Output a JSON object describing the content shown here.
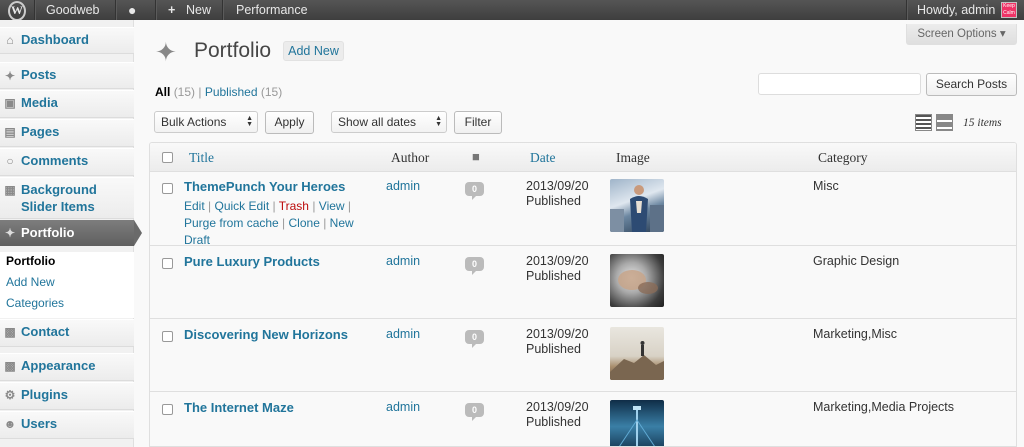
{
  "adminbar": {
    "site_name": "Goodweb",
    "new_label": "New",
    "performance_label": "Performance",
    "howdy": "Howdy, admin"
  },
  "sidebar": {
    "items": [
      {
        "label": "Dashboard",
        "icon": "dashboard-icon"
      },
      {
        "label": "Posts",
        "icon": "pin-icon"
      },
      {
        "label": "Media",
        "icon": "media-icon"
      },
      {
        "label": "Pages",
        "icon": "pages-icon"
      },
      {
        "label": "Comments",
        "icon": "comments-icon"
      },
      {
        "label": "Background Slider Items",
        "icon": "slider-icon"
      },
      {
        "label": "Portfolio",
        "icon": "pin-icon"
      },
      {
        "label": "Contact",
        "icon": "contact-icon"
      },
      {
        "label": "Appearance",
        "icon": "appearance-icon"
      },
      {
        "label": "Plugins",
        "icon": "plugins-icon"
      },
      {
        "label": "Users",
        "icon": "users-icon"
      }
    ],
    "submenu": [
      "Portfolio",
      "Add New",
      "Categories"
    ]
  },
  "header": {
    "screen_options": "Screen Options",
    "title": "Portfolio",
    "add_new": "Add New"
  },
  "filters": {
    "all_label": "All",
    "all_count": "(15)",
    "published_label": "Published",
    "published_count": "(15)",
    "search_button": "Search Posts",
    "bulk_actions": "Bulk Actions",
    "apply": "Apply",
    "dates": "Show all dates",
    "filter": "Filter",
    "items_count": "15 items"
  },
  "table": {
    "columns": [
      "Title",
      "Author",
      "Date",
      "Image",
      "Category"
    ],
    "row_actions": [
      "Edit",
      "Quick Edit",
      "Trash",
      "View",
      "Purge from cache",
      "Clone",
      "New Draft"
    ],
    "rows": [
      {
        "title": "ThemePunch Your Heroes",
        "author": "admin",
        "comments": "0",
        "date": "2013/09/20",
        "status": "Published",
        "category": "Misc"
      },
      {
        "title": "Pure Luxury Products",
        "author": "admin",
        "comments": "0",
        "date": "2013/09/20",
        "status": "Published",
        "category": "Graphic Design"
      },
      {
        "title": "Discovering New Horizons",
        "author": "admin",
        "comments": "0",
        "date": "2013/09/20",
        "status": "Published",
        "category": "Marketing,Misc"
      },
      {
        "title": "The Internet Maze",
        "author": "admin",
        "comments": "0",
        "date": "2013/09/20",
        "status": "Published",
        "category": "Marketing,Media Projects"
      }
    ]
  }
}
